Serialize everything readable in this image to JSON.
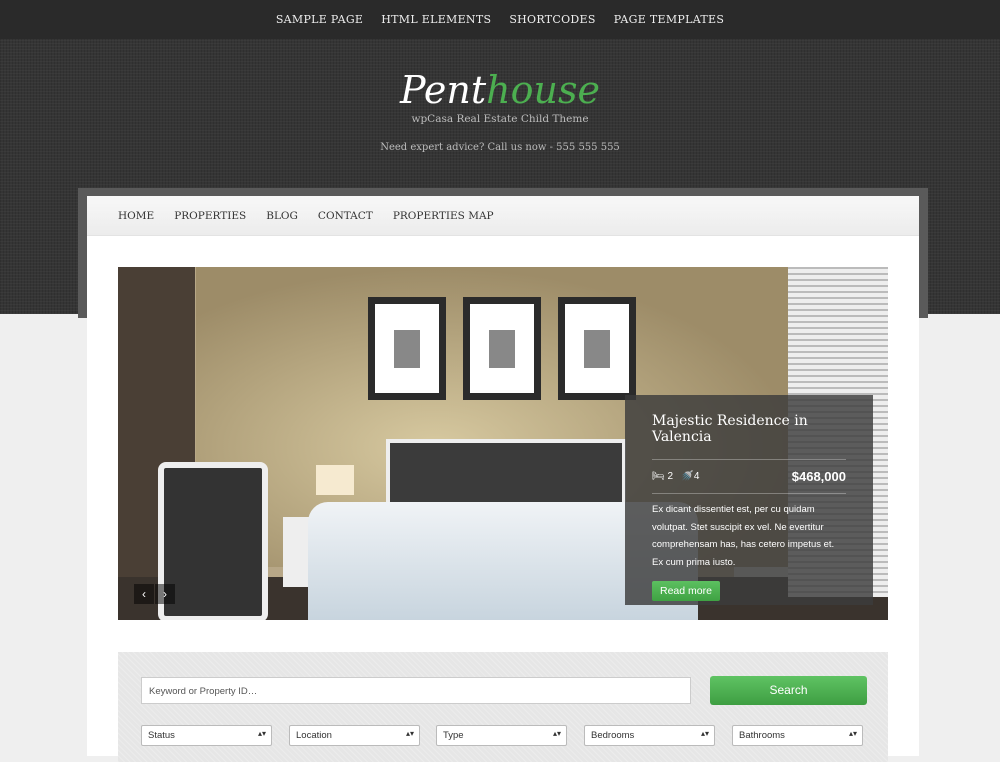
{
  "top_nav": [
    "SAMPLE PAGE",
    "HTML ELEMENTS",
    "SHORTCODES",
    "PAGE TEMPLATES"
  ],
  "logo": {
    "part1": "Pent",
    "part2": "house"
  },
  "tagline": "wpCasa Real Estate Child Theme",
  "advice": "Need expert advice? Call us now - 555 555 555",
  "main_nav": [
    "HOME",
    "PROPERTIES",
    "BLOG",
    "CONTACT",
    "PROPERTIES MAP"
  ],
  "slide": {
    "title": "Majestic Residence in Valencia",
    "beds": "2",
    "baths": "4",
    "price": "$468,000",
    "excerpt": "Ex dicant dissentiet est, per cu quidam volutpat. Stet suscipit ex vel. Ne evertitur comprehensam has, has cetero impetus et. Ex cum prima iusto.",
    "button": "Read more",
    "prev": "‹",
    "next": "›"
  },
  "search": {
    "placeholder": "Keyword or Property ID…",
    "button": "Search",
    "selects": [
      "Status",
      "Location",
      "Type",
      "Bedrooms",
      "Bathrooms"
    ]
  },
  "colors": {
    "accent": "#4caf50",
    "header_bg": "#353535"
  }
}
